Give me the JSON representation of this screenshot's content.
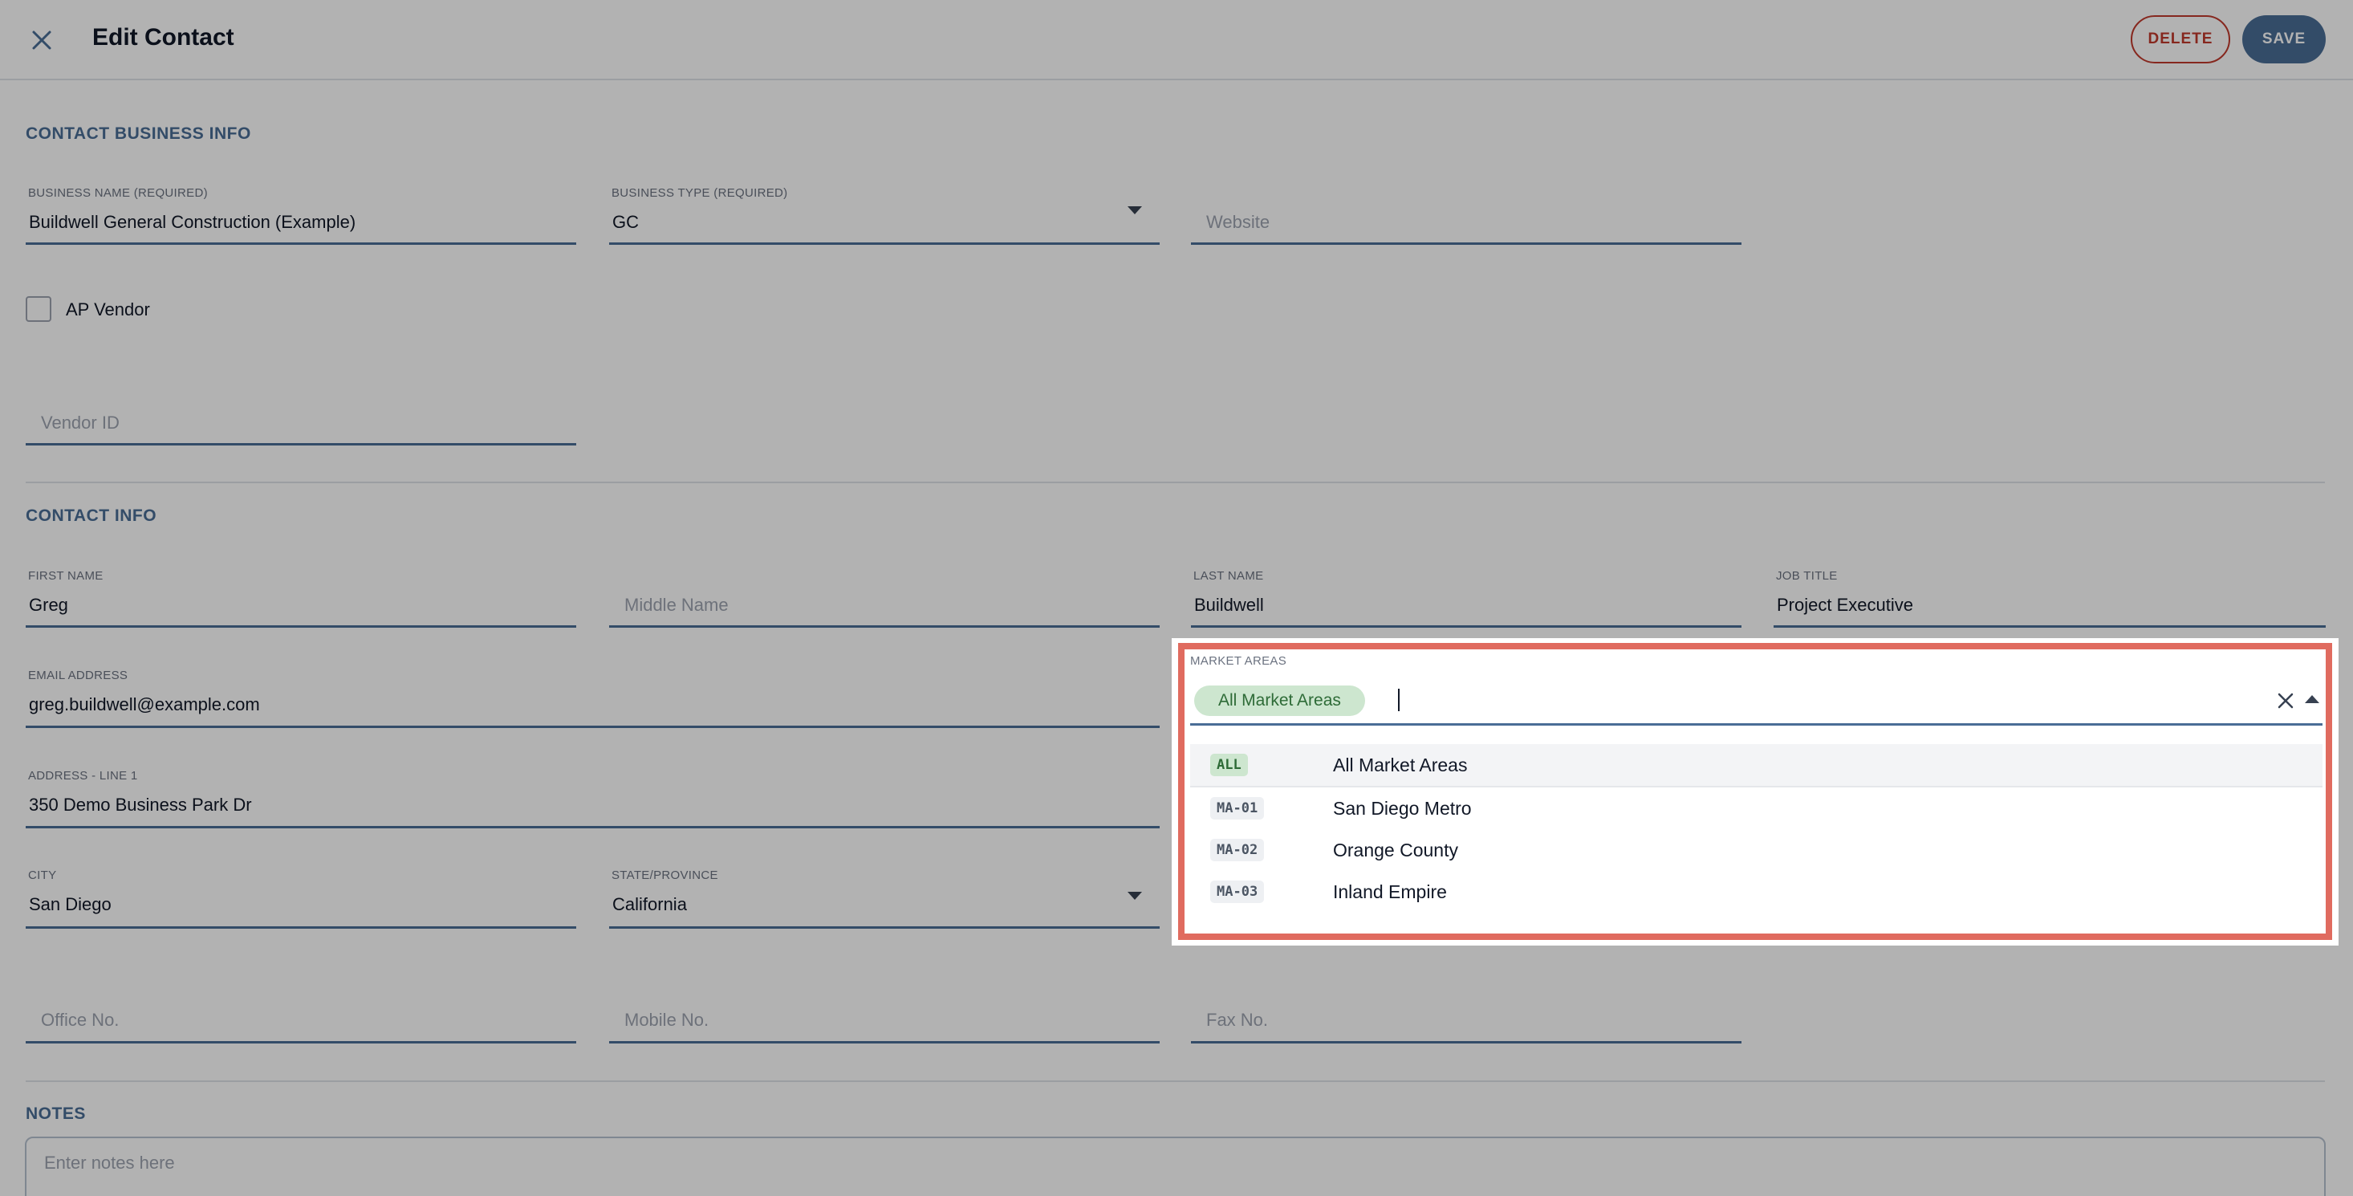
{
  "header": {
    "title": "Edit Contact",
    "delete_label": "DELETE",
    "save_label": "SAVE"
  },
  "business": {
    "section_title": "CONTACT BUSINESS INFO",
    "business_name": {
      "label": "BUSINESS NAME (REQUIRED)",
      "value": "Buildwell General Construction (Example)"
    },
    "business_type": {
      "label": "BUSINESS TYPE (REQUIRED)",
      "value": "GC"
    },
    "website": {
      "placeholder": "Website"
    },
    "ap_vendor": {
      "label": "AP Vendor",
      "checked": false
    },
    "vendor_id": {
      "placeholder": "Vendor ID"
    }
  },
  "contact": {
    "section_title": "CONTACT INFO",
    "first_name": {
      "label": "FIRST NAME",
      "value": "Greg"
    },
    "middle_name": {
      "placeholder": "Middle Name"
    },
    "last_name": {
      "label": "LAST NAME",
      "value": "Buildwell"
    },
    "job_title": {
      "label": "JOB TITLE",
      "value": "Project Executive"
    },
    "email": {
      "label": "EMAIL ADDRESS",
      "value": "greg.buildwell@example.com"
    },
    "address1": {
      "label": "ADDRESS - LINE 1",
      "value": "350 Demo Business Park Dr"
    },
    "city": {
      "label": "CITY",
      "value": "San Diego"
    },
    "state": {
      "label": "STATE/PROVINCE",
      "value": "California"
    },
    "office": {
      "placeholder": "Office No."
    },
    "mobile": {
      "placeholder": "Mobile No."
    },
    "fax": {
      "placeholder": "Fax No."
    }
  },
  "notes": {
    "section_title": "NOTES",
    "placeholder": "Enter notes here"
  },
  "market_areas": {
    "label": "MARKET AREAS",
    "selected_chip": "All Market Areas",
    "options": [
      {
        "code": "ALL",
        "name": "All Market Areas"
      },
      {
        "code": "MA-01",
        "name": "San Diego Metro"
      },
      {
        "code": "MA-02",
        "name": "Orange County"
      },
      {
        "code": "MA-03",
        "name": "Inland Empire"
      }
    ]
  },
  "colors": {
    "accent": "#4a6d96",
    "delete": "#c0392b",
    "highlight_frame": "#e06b5f",
    "chip_bg": "#cde6cf",
    "chip_text": "#2e6b37"
  },
  "icons": {
    "close": "close-icon",
    "dropdown": "chevron-down-icon",
    "clear": "clear-icon",
    "collapse": "chevron-up-icon"
  }
}
